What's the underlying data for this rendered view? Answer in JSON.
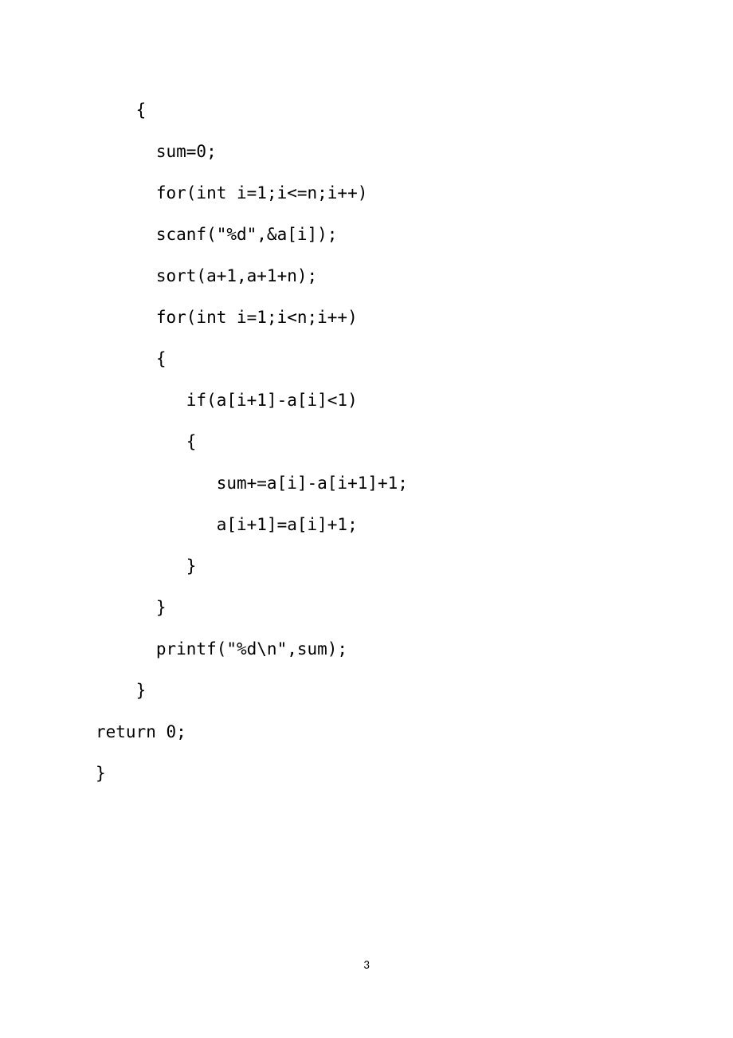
{
  "code": {
    "lines": [
      "    {",
      "      sum=0;",
      "      for(int i=1;i<=n;i++)",
      "      scanf(\"%d\",&a[i]);",
      "",
      "      sort(a+1,a+1+n);",
      "",
      "      for(int i=1;i<n;i++)",
      "      {",
      "         if(a[i+1]-a[i]<1)",
      "         {",
      "            sum+=a[i]-a[i+1]+1;",
      "            a[i+1]=a[i]+1;",
      "",
      "         }",
      "",
      "      }",
      "      printf(\"%d\\n\",sum);",
      "    }",
      "return 0;",
      "}"
    ]
  },
  "page_number": "3"
}
